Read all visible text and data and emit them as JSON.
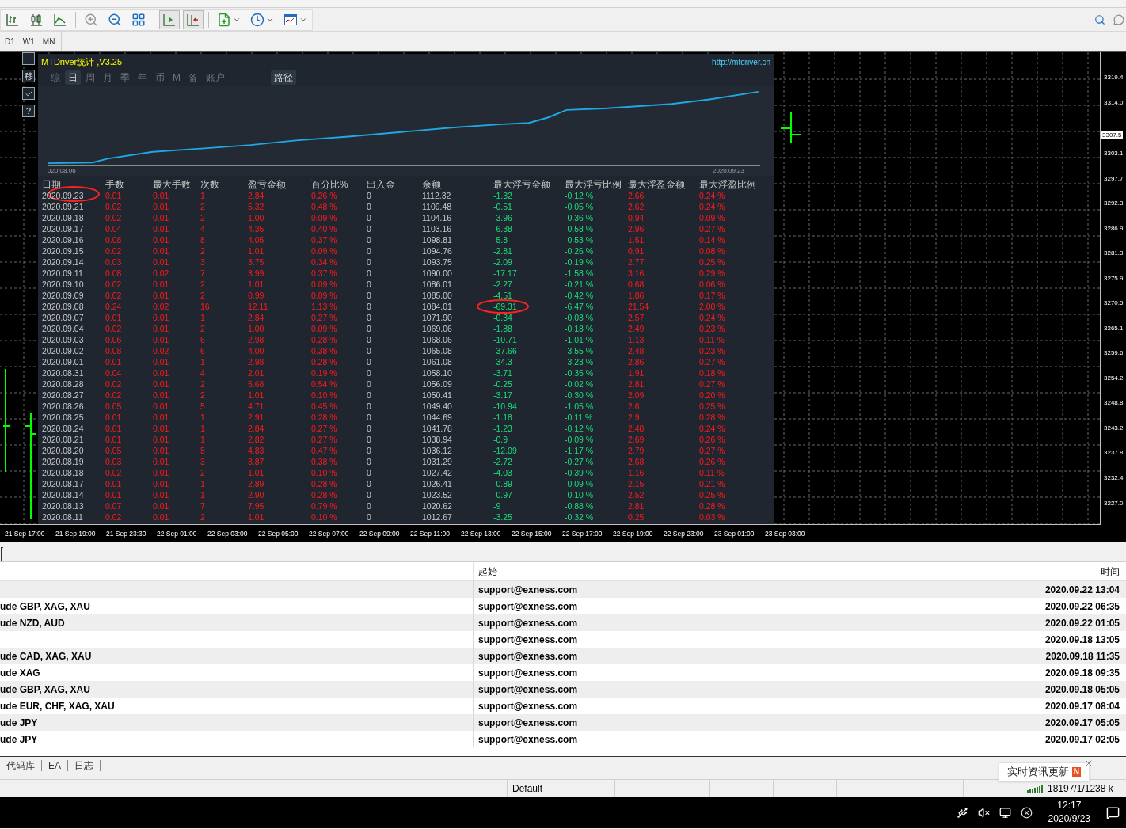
{
  "toolbar_buttons": [
    {
      "kind": "bars",
      "pressed": false
    },
    {
      "kind": "candles",
      "pressed": false
    },
    {
      "kind": "line",
      "pressed": false
    },
    {
      "kind": "zoom_in",
      "pressed": false
    },
    {
      "kind": "zoom_out",
      "pressed": false
    },
    {
      "kind": "tile",
      "pressed": false
    },
    {
      "kind": "autoscroll",
      "pressed": true
    },
    {
      "kind": "shift",
      "pressed": true
    },
    {
      "kind": "indicator",
      "pressed": false
    },
    {
      "kind": "periods",
      "pressed": false
    },
    {
      "kind": "template",
      "pressed": false
    }
  ],
  "timeframes": [
    "D1",
    "W1",
    "MN"
  ],
  "side_buttons": [
    {
      "kind": "text",
      "label": "−"
    },
    {
      "kind": "text",
      "label": "移"
    },
    {
      "kind": "check"
    },
    {
      "kind": "text",
      "label": "?"
    }
  ],
  "stats_panel": {
    "title": "MTDriver统计 ,V3.25",
    "link": "http://mtdriver.cn",
    "tabs": [
      {
        "label": "综",
        "selected": false
      },
      {
        "label": "日",
        "selected": true
      },
      {
        "label": "周",
        "selected": false
      },
      {
        "label": "月",
        "selected": false
      },
      {
        "label": "季",
        "selected": false
      },
      {
        "label": "年",
        "selected": false
      },
      {
        "label": "币",
        "selected": false
      },
      {
        "label": "M",
        "selected": false
      },
      {
        "label": "备",
        "selected": false
      },
      {
        "label": "账户",
        "selected": false
      }
    ],
    "path_button": "路径",
    "curve": {
      "start_label": "020.08.06",
      "end_label": "2020.09.23"
    },
    "columns": [
      {
        "label": "日期",
        "kind": "plain"
      },
      {
        "label": "手数",
        "kind": "red"
      },
      {
        "label": "最大手数",
        "kind": "red"
      },
      {
        "label": "次数",
        "kind": "red"
      },
      {
        "label": "盈亏金额",
        "kind": "red"
      },
      {
        "label": "百分比%",
        "kind": "red"
      },
      {
        "label": "出入金",
        "kind": "plain"
      },
      {
        "label": "余额",
        "kind": "plain"
      },
      {
        "label": "最大浮亏金额",
        "kind": "green"
      },
      {
        "label": "最大浮亏比例",
        "kind": "green"
      },
      {
        "label": "最大浮盈金额",
        "kind": "red"
      },
      {
        "label": "最大浮盈比例",
        "kind": "red"
      }
    ],
    "rows": [
      [
        "2020.09.23",
        "0.01",
        "0.01",
        "1",
        "2.84",
        "0.26 %",
        "0",
        "1112.32",
        "-1.32",
        "-0.12 %",
        "2.66",
        "0.24 %"
      ],
      [
        "2020.09.21",
        "0.02",
        "0.01",
        "2",
        "5.32",
        "0.48 %",
        "0",
        "1109.48",
        "-0.51",
        "-0.05 %",
        "2.62",
        "0.24 %"
      ],
      [
        "2020.09.18",
        "0.02",
        "0.01",
        "2",
        "1.00",
        "0.09 %",
        "0",
        "1104.16",
        "-3.96",
        "-0.36 %",
        "0.94",
        "0.09 %"
      ],
      [
        "2020.09.17",
        "0.04",
        "0.01",
        "4",
        "4.35",
        "0.40 %",
        "0",
        "1103.16",
        "-6.38",
        "-0.58 %",
        "2.96",
        "0.27 %"
      ],
      [
        "2020.09.16",
        "0.08",
        "0.01",
        "8",
        "4.05",
        "0.37 %",
        "0",
        "1098.81",
        "-5.8",
        "-0.53 %",
        "1.51",
        "0.14 %"
      ],
      [
        "2020.09.15",
        "0.02",
        "0.01",
        "2",
        "1.01",
        "0.09 %",
        "0",
        "1094.76",
        "-2.81",
        "-0.26 %",
        "0.91",
        "0.08 %"
      ],
      [
        "2020.09.14",
        "0.03",
        "0.01",
        "3",
        "3.75",
        "0.34 %",
        "0",
        "1093.75",
        "-2.09",
        "-0.19 %",
        "2.77",
        "0.25 %"
      ],
      [
        "2020.09.11",
        "0.08",
        "0.02",
        "7",
        "3.99",
        "0.37 %",
        "0",
        "1090.00",
        "-17.17",
        "-1.58 %",
        "3.16",
        "0.29 %"
      ],
      [
        "2020.09.10",
        "0.02",
        "0.01",
        "2",
        "1.01",
        "0.09 %",
        "0",
        "1086.01",
        "-2.27",
        "-0.21 %",
        "0.68",
        "0.06 %"
      ],
      [
        "2020.09.09",
        "0.02",
        "0.01",
        "2",
        "0.99",
        "0.09 %",
        "0",
        "1085.00",
        "-4.51",
        "-0.42 %",
        "1.86",
        "0.17 %"
      ],
      [
        "2020.09.08",
        "0.24",
        "0.02",
        "16",
        "12.11",
        "1.13 %",
        "0",
        "1084.01",
        "-69.31",
        "-6.47 %",
        "21.54",
        "2.00 %"
      ],
      [
        "2020.09.07",
        "0.01",
        "0.01",
        "1",
        "2.84",
        "0.27 %",
        "0",
        "1071.90",
        "-0.34",
        "-0.03 %",
        "2.57",
        "0.24 %"
      ],
      [
        "2020.09.04",
        "0.02",
        "0.01",
        "2",
        "1.00",
        "0.09 %",
        "0",
        "1069.06",
        "-1.88",
        "-0.18 %",
        "2.49",
        "0.23 %"
      ],
      [
        "2020.09.03",
        "0.06",
        "0.01",
        "6",
        "2.98",
        "0.28 %",
        "0",
        "1068.06",
        "-10.71",
        "-1.01 %",
        "1.13",
        "0.11 %"
      ],
      [
        "2020.09.02",
        "0.08",
        "0.02",
        "6",
        "4.00",
        "0.38 %",
        "0",
        "1065.08",
        "-37.66",
        "-3.55 %",
        "2.48",
        "0.23 %"
      ],
      [
        "2020.09.01",
        "0.01",
        "0.01",
        "1",
        "2.98",
        "0.28 %",
        "0",
        "1061.08",
        "-34.3",
        "-3.23 %",
        "2.86",
        "0.27 %"
      ],
      [
        "2020.08.31",
        "0.04",
        "0.01",
        "4",
        "2.01",
        "0.19 %",
        "0",
        "1058.10",
        "-3.71",
        "-0.35 %",
        "1.91",
        "0.18 %"
      ],
      [
        "2020.08.28",
        "0.02",
        "0.01",
        "2",
        "5.68",
        "0.54 %",
        "0",
        "1056.09",
        "-0.25",
        "-0.02 %",
        "2.81",
        "0.27 %"
      ],
      [
        "2020.08.27",
        "0.02",
        "0.01",
        "2",
        "1.01",
        "0.10 %",
        "0",
        "1050.41",
        "-3.17",
        "-0.30 %",
        "2.09",
        "0.20 %"
      ],
      [
        "2020.08.26",
        "0.05",
        "0.01",
        "5",
        "4.71",
        "0.45 %",
        "0",
        "1049.40",
        "-10.94",
        "-1.05 %",
        "2.6",
        "0.25 %"
      ],
      [
        "2020.08.25",
        "0.01",
        "0.01",
        "1",
        "2.91",
        "0.28 %",
        "0",
        "1044.69",
        "-1.18",
        "-0.11 %",
        "2.9",
        "0.28 %"
      ],
      [
        "2020.08.24",
        "0.01",
        "0.01",
        "1",
        "2.84",
        "0.27 %",
        "0",
        "1041.78",
        "-1.23",
        "-0.12 %",
        "2.48",
        "0.24 %"
      ],
      [
        "2020.08.21",
        "0.01",
        "0.01",
        "1",
        "2.82",
        "0.27 %",
        "0",
        "1038.94",
        "-0.9",
        "-0.09 %",
        "2.69",
        "0.26 %"
      ],
      [
        "2020.08.20",
        "0.05",
        "0.01",
        "5",
        "4.83",
        "0.47 %",
        "0",
        "1036.12",
        "-12.09",
        "-1.17 %",
        "2.79",
        "0.27 %"
      ],
      [
        "2020.08.19",
        "0.03",
        "0.01",
        "3",
        "3.87",
        "0.38 %",
        "0",
        "1031.29",
        "-2.72",
        "-0.27 %",
        "2.68",
        "0.26 %"
      ],
      [
        "2020.08.18",
        "0.02",
        "0.01",
        "2",
        "1.01",
        "0.10 %",
        "0",
        "1027.42",
        "-4.03",
        "-0.39 %",
        "1.16",
        "0.11 %"
      ],
      [
        "2020.08.17",
        "0.01",
        "0.01",
        "1",
        "2.89",
        "0.28 %",
        "0",
        "1026.41",
        "-0.89",
        "-0.09 %",
        "2.15",
        "0.21 %"
      ],
      [
        "2020.08.14",
        "0.01",
        "0.01",
        "1",
        "2.90",
        "0.28 %",
        "0",
        "1023.52",
        "-0.97",
        "-0.10 %",
        "2.52",
        "0.25 %"
      ],
      [
        "2020.08.13",
        "0.07",
        "0.01",
        "7",
        "7.95",
        "0.79 %",
        "0",
        "1020.62",
        "-9",
        "-0.88 %",
        "2.81",
        "0.28 %"
      ],
      [
        "2020.08.11",
        "0.02",
        "0.01",
        "2",
        "1.01",
        "0.10 %",
        "0",
        "1012.67",
        "-3.25",
        "-0.32 %",
        "0.25",
        "0.03 %"
      ]
    ]
  },
  "price_axis": {
    "labels": [
      "3319.4",
      "3314.0",
      "3303.1",
      "3297.7",
      "3292.3",
      "3286.9",
      "3281.3",
      "3275.9",
      "3270.5",
      "3265.1",
      "3259.6",
      "3254.2",
      "3248.8",
      "3243.2",
      "3237.8",
      "3232.4",
      "3227.0"
    ],
    "current_price": "3307.5"
  },
  "time_axis": [
    "21 Sep 17:00",
    "21 Sep 19:00",
    "21 Sep 23:30",
    "22 Sep 01:00",
    "22 Sep 03:00",
    "22 Sep 05:00",
    "22 Sep 07:00",
    "22 Sep 09:00",
    "22 Sep 11:00",
    "22 Sep 13:00",
    "22 Sep 15:00",
    "22 Sep 17:00",
    "22 Sep 19:00",
    "22 Sep 23:00",
    "23 Sep 01:00",
    "23 Sep 03:00"
  ],
  "news": {
    "columns": [
      "起始",
      "时间"
    ],
    "rows": [
      {
        "from": "support@exness.com",
        "time": "2020.09.22 13:04"
      },
      {
        "subject": "ude GBP, XAG, XAU",
        "from": "support@exness.com",
        "time": "2020.09.22 06:35"
      },
      {
        "subject": "ude NZD, AUD",
        "from": "support@exness.com",
        "time": "2020.09.22 01:05"
      },
      {
        "from": "support@exness.com",
        "time": "2020.09.18 13:05"
      },
      {
        "subject": "ude CAD, XAG, XAU",
        "from": "support@exness.com",
        "time": "2020.09.18 11:35"
      },
      {
        "subject": "ude XAG",
        "from": "support@exness.com",
        "time": "2020.09.18 09:35"
      },
      {
        "subject": "ude GBP, XAG, XAU",
        "from": "support@exness.com",
        "time": "2020.09.18 05:05"
      },
      {
        "subject": "ude EUR, CHF, XAG, XAU",
        "from": "support@exness.com",
        "time": "2020.09.17 08:04"
      },
      {
        "subject": "ude JPY",
        "from": "support@exness.com",
        "time": "2020.09.17 05:05"
      },
      {
        "subject": "ude JPY",
        "from": "support@exness.com",
        "time": "2020.09.17 02:05"
      }
    ]
  },
  "bottom_tabs": [
    "代码库",
    "EA",
    "日志"
  ],
  "status_bar": {
    "profile": "Default",
    "traffic": "18197/1/1238 k"
  },
  "popup": {
    "text": "实时资讯更新",
    "badge": "N"
  },
  "taskbar": {
    "time": "12:17",
    "date": "2020/9/23"
  }
}
